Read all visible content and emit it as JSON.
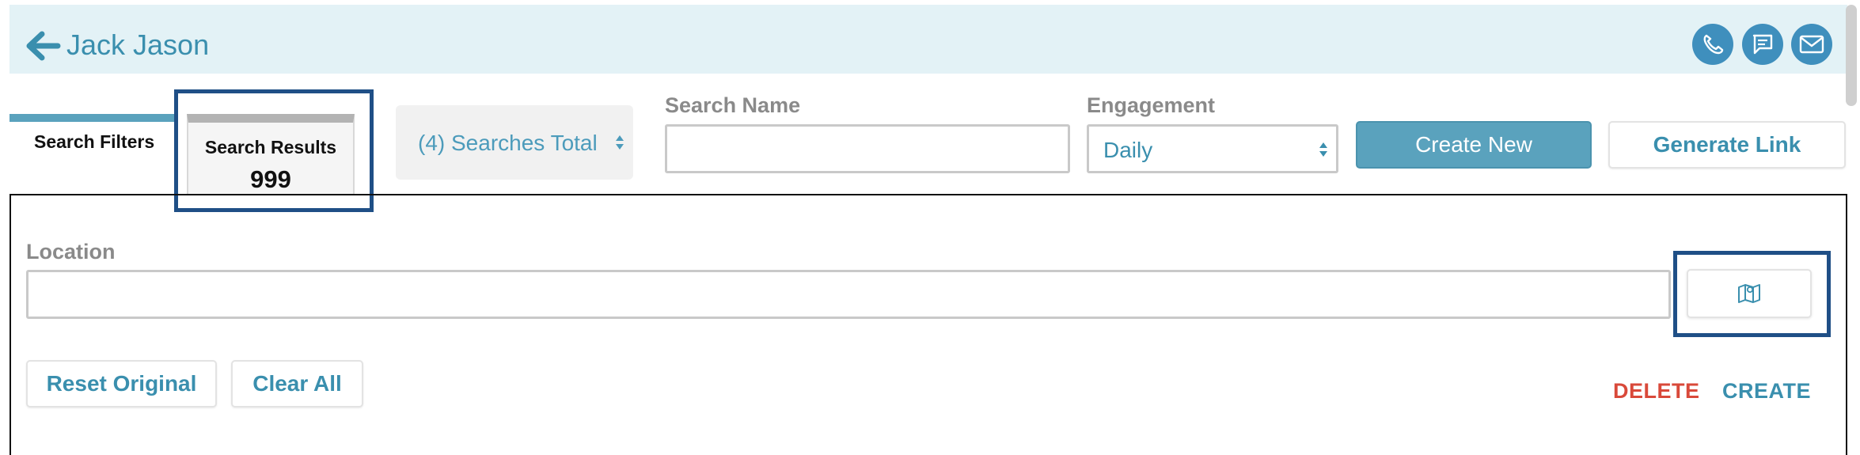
{
  "header": {
    "title": "Jack Jason",
    "icons": [
      "phone-icon",
      "chat-icon",
      "mail-icon"
    ]
  },
  "tabs": [
    {
      "label": "Search Filters",
      "active": true
    },
    {
      "label": "Search Results",
      "count": "999",
      "active": false
    }
  ],
  "searches_total": {
    "label": "(4) Searches Total"
  },
  "search_name": {
    "label": "Search Name",
    "value": "",
    "placeholder": ""
  },
  "engagement": {
    "label": "Engagement",
    "selected": "Daily"
  },
  "buttons": {
    "create_new": "Create New",
    "generate_link": "Generate Link",
    "reset_original": "Reset Original",
    "clear_all": "Clear All",
    "delete": "DELETE",
    "create": "CREATE"
  },
  "location": {
    "label": "Location",
    "value": "",
    "placeholder": ""
  },
  "colors": {
    "accent": "#3a8fae",
    "primary_button": "#5aa2bd",
    "header_bg": "#e3f2f6",
    "delete": "#d9493a",
    "highlight_border": "#1f4f86"
  }
}
